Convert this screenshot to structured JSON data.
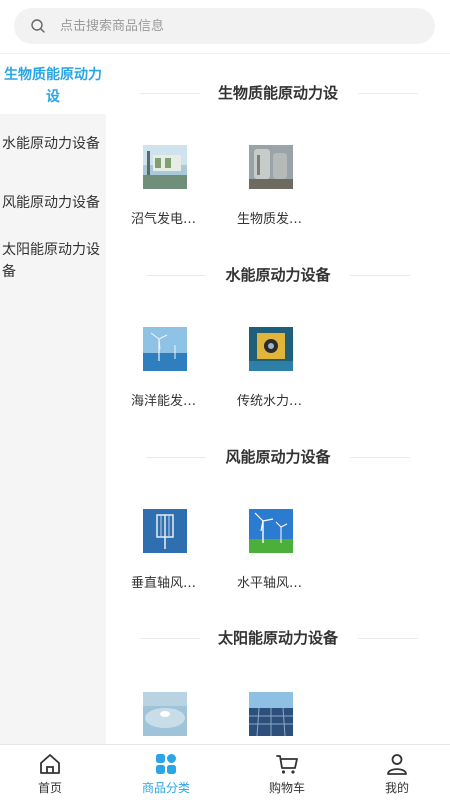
{
  "search": {
    "placeholder": "点击搜索商品信息"
  },
  "sidebar": {
    "items": [
      {
        "label_line1": "生物质能原动力",
        "label_line2": "设"
      },
      {
        "label": "水能原动力设备"
      },
      {
        "label": "风能原动力设备"
      },
      {
        "label_line1": "太阳能原动力设",
        "label_line2": "备"
      }
    ]
  },
  "sections": [
    {
      "title": "生物质能原动力设",
      "products": [
        {
          "name": "沼气发电…"
        },
        {
          "name": "生物质发…"
        }
      ]
    },
    {
      "title": "水能原动力设备",
      "products": [
        {
          "name": "海洋能发…"
        },
        {
          "name": "传统水力…"
        }
      ]
    },
    {
      "title": "风能原动力设备",
      "products": [
        {
          "name": "垂直轴风…"
        },
        {
          "name": "水平轴风…"
        }
      ]
    },
    {
      "title": "太阳能原动力设备",
      "products": [
        {
          "name": ""
        },
        {
          "name": ""
        }
      ]
    }
  ],
  "tabbar": {
    "items": [
      {
        "label": "首页"
      },
      {
        "label": "商品分类"
      },
      {
        "label": "购物车"
      },
      {
        "label": "我的"
      }
    ]
  },
  "colors": {
    "accent": "#2aa5e6",
    "sidebar_bg": "#f5f5f5",
    "text": "#333333"
  }
}
